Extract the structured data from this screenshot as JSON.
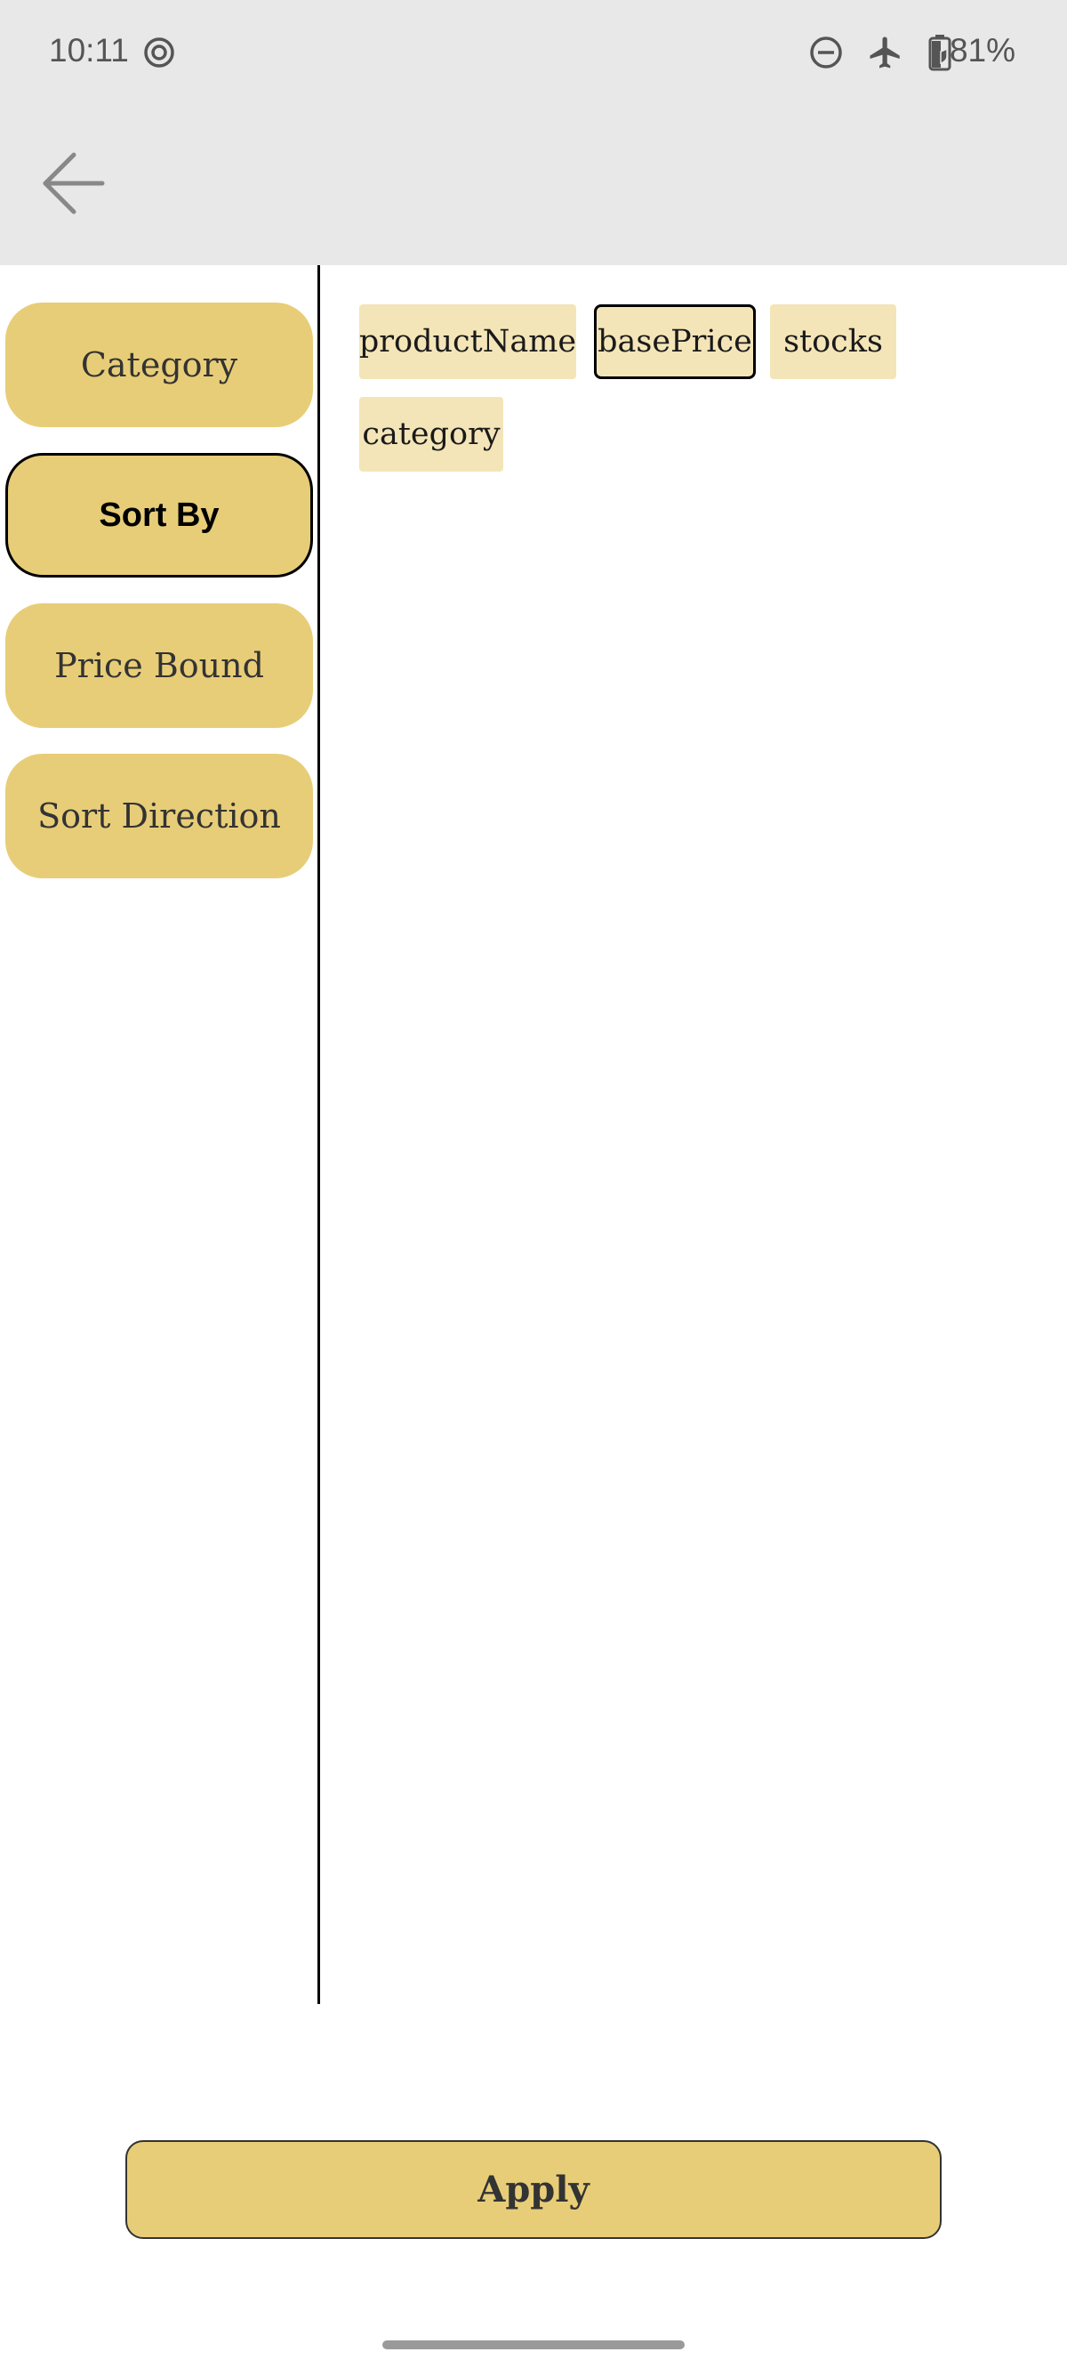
{
  "status_bar": {
    "time": "10:11",
    "battery": "81%",
    "icons": [
      "focus-mode-icon",
      "do-not-disturb-icon",
      "airplane-icon",
      "battery-saver-icon"
    ]
  },
  "app_bar": {
    "back_icon": "arrow-back-icon"
  },
  "sidebar": {
    "items": [
      {
        "label": "Category",
        "active": false
      },
      {
        "label": "Sort By",
        "active": true
      },
      {
        "label": "Price Bound",
        "active": false
      },
      {
        "label": "Sort Direction",
        "active": false
      }
    ]
  },
  "options": {
    "chips": [
      {
        "label": "productName",
        "selected": false
      },
      {
        "label": "basePrice",
        "selected": true
      },
      {
        "label": "stocks",
        "selected": false
      },
      {
        "label": "category",
        "selected": false
      }
    ]
  },
  "footer": {
    "apply_label": "Apply"
  },
  "colors": {
    "accent": "#e8cd78",
    "chip_bg": "#f4e5b8",
    "topbar_bg": "#e8e8e8"
  }
}
